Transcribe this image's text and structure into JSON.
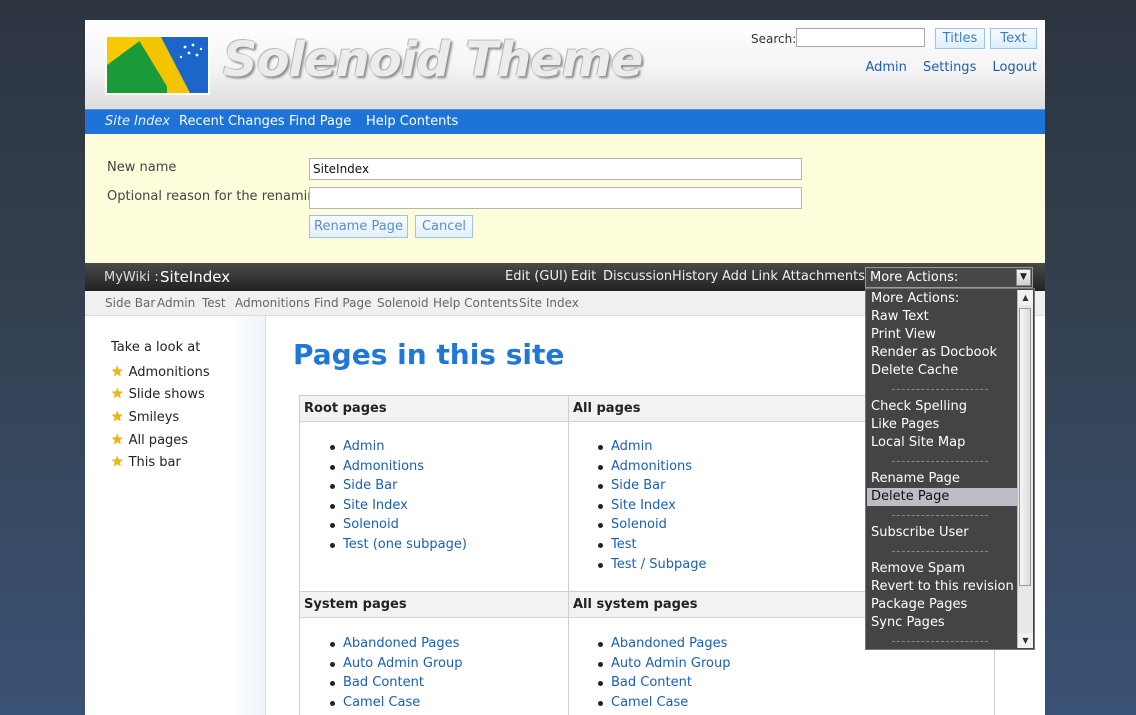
{
  "header": {
    "title": "Solenoid Theme",
    "search_label": "Search:",
    "search_value": "",
    "titles_button": "Titles",
    "text_button": "Text",
    "user_links": [
      "Admin",
      "Settings",
      "Logout"
    ]
  },
  "navbar": {
    "items": [
      "Site Index",
      "Recent Changes",
      "Find Page",
      "Help Contents"
    ]
  },
  "rename_form": {
    "new_name_label": "New name",
    "new_name_value": "SiteIndex",
    "reason_label": "Optional reason for the renaming",
    "reason_value": "",
    "rename_button": "Rename Page",
    "cancel_button": "Cancel"
  },
  "titlebar": {
    "wiki_name": "MyWiki",
    "separator": ":",
    "page_name": "SiteIndex",
    "actions": [
      "Edit (GUI)",
      "Edit",
      "Discussion",
      "History",
      "Add Link",
      "Attachments"
    ]
  },
  "more_actions": {
    "selected": "More Actions:",
    "options": [
      "More Actions:",
      "Raw Text",
      "Print View",
      "Render as Docbook",
      "Delete Cache",
      "Check Spelling",
      "Like Pages",
      "Local Site Map",
      "Rename Page",
      "Delete Page",
      "Subscribe User",
      "Remove Spam",
      "Revert to this revision",
      "Package Pages",
      "Sync Pages"
    ],
    "highlighted": "Delete Page"
  },
  "trail": [
    "Side Bar",
    "Admin",
    "Test",
    "Admonitions",
    "Find Page",
    "Solenoid",
    "Help Contents",
    "Site Index"
  ],
  "sidebar": {
    "heading": "Take a look at",
    "items": [
      "Admonitions",
      "Slide shows",
      "Smileys",
      "All pages",
      "This bar"
    ]
  },
  "content": {
    "title": "Pages in this site",
    "root_pages_header": "Root pages",
    "root_pages": [
      "Admin",
      "Admonitions",
      "Side Bar",
      "Site Index",
      "Solenoid",
      "Test (one subpage)"
    ],
    "all_pages_header": "All pages",
    "all_pages": [
      "Admin",
      "Admonitions",
      "Side Bar",
      "Site Index",
      "Solenoid",
      "Test",
      "Test / Subpage"
    ],
    "system_pages_header": "System pages",
    "system_pages": [
      "Abandoned Pages",
      "Auto Admin Group",
      "Bad Content",
      "Camel Case"
    ],
    "all_system_pages_header": "All system pages",
    "all_system_pages": [
      "Abandoned Pages",
      "Auto Admin Group",
      "Bad Content",
      "Camel Case"
    ]
  }
}
